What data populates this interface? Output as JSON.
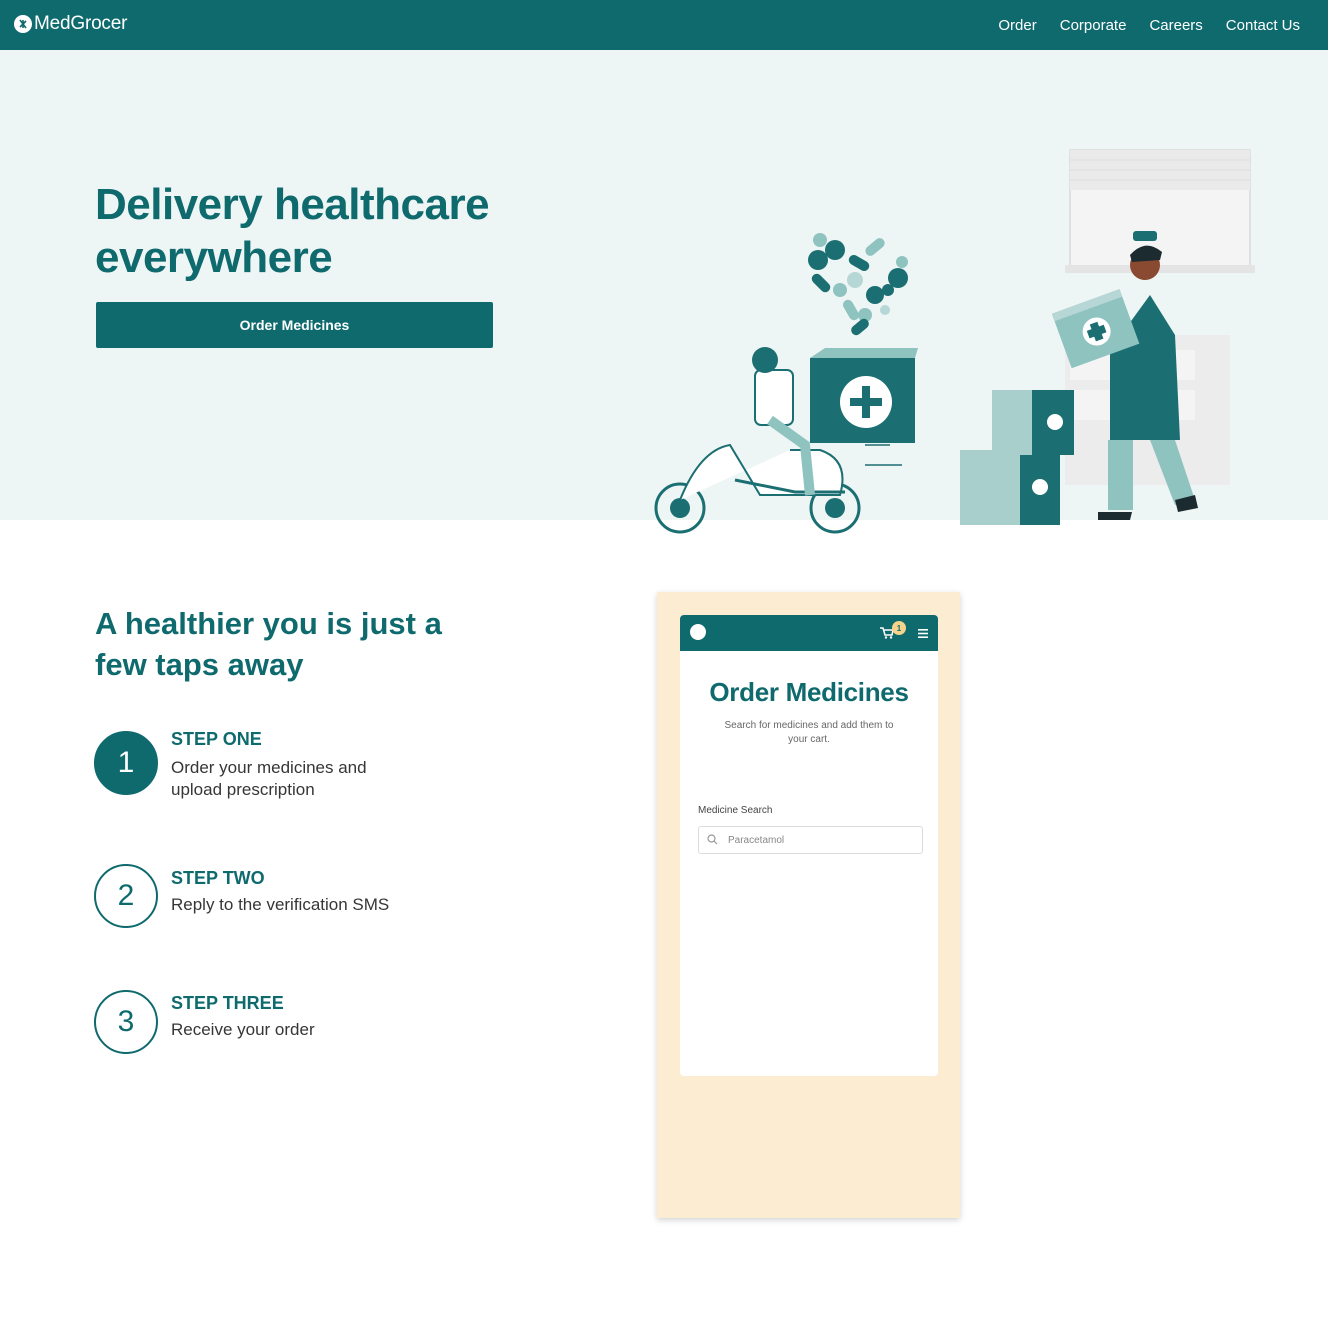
{
  "navbar": {
    "brand": "MedGrocer",
    "links": [
      "Order",
      "Corporate",
      "Careers",
      "Contact Us"
    ]
  },
  "hero": {
    "title": "Delivery healthcare everywhere",
    "cta_label": "Order Medicines"
  },
  "steps_section": {
    "title": "A healthier you is just a few taps away",
    "steps": [
      {
        "number": "1",
        "heading": "STEP ONE",
        "description": "Order your medicines and upload prescription"
      },
      {
        "number": "2",
        "heading": "STEP TWO",
        "description": "Reply to the verification SMS"
      },
      {
        "number": "3",
        "heading": "STEP THREE",
        "description": "Receive your order"
      }
    ]
  },
  "phone_mockup": {
    "cart_count": "1",
    "title": "Order Medicines",
    "subtitle": "Search for medicines and add them to your cart.",
    "search_label": "Medicine Search",
    "search_placeholder": "Paracetamol"
  },
  "colors": {
    "primary": "#0f6a6e",
    "hero_bg": "#eef5f5",
    "mockup_bg": "#fcedd2",
    "accent_light": "#8fc3c0"
  }
}
